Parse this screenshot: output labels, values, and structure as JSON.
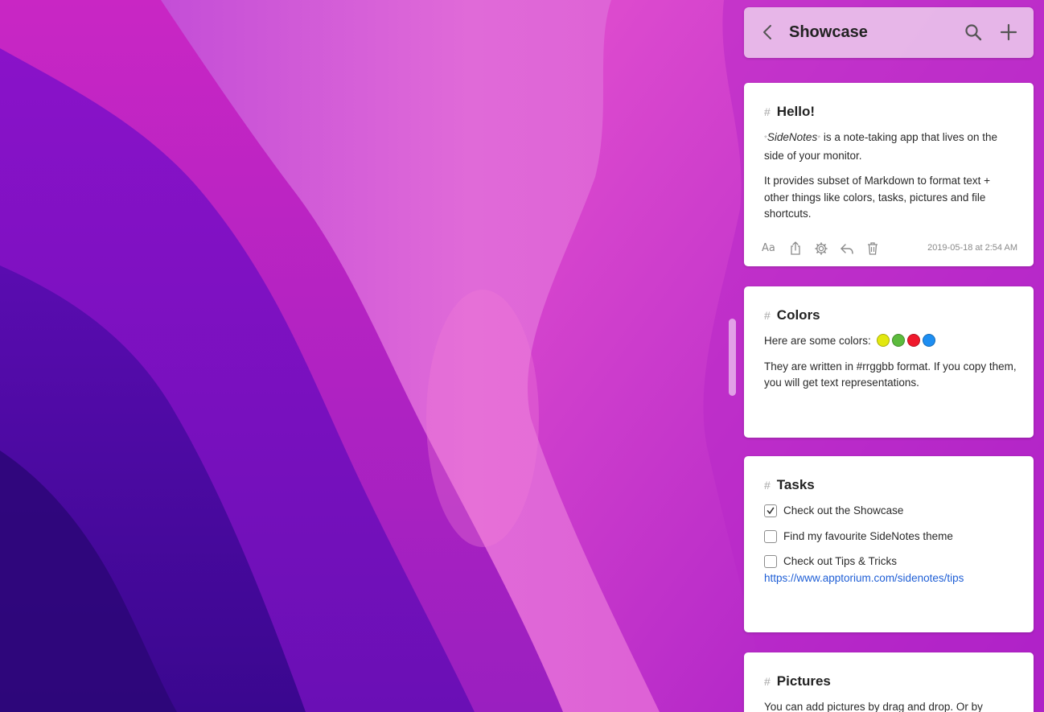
{
  "header": {
    "title": "Showcase",
    "back_icon": "chevron-left-icon",
    "search_icon": "search-icon",
    "add_icon": "plus-icon"
  },
  "notes": [
    {
      "title": "Hello!",
      "p1_app": "SideNotes",
      "p1_rest": " is a note-taking app that lives on the side of your monitor.",
      "p2": "It provides subset of Markdown to format text + other things like colors, tasks, pictures and file shortcuts.",
      "toolbar": {
        "font_label": "Aa",
        "timestamp": "2019-05-18 at 2:54 AM"
      }
    },
    {
      "title": "Colors",
      "p1": "Here are some colors:",
      "colors": [
        "#e2e80f",
        "#5cbb3d",
        "#f0192c",
        "#1d8ef2"
      ],
      "p2": "They are written in #rrggbb format. If you copy them, you will get text representations."
    },
    {
      "title": "Tasks",
      "tasks": [
        {
          "label": "Check out the Showcase",
          "done": true
        },
        {
          "label": "Find my favourite SideNotes theme",
          "done": false
        },
        {
          "label": "Check out Tips & Tricks ",
          "link": "https://www.apptorium.com/sidenotes/tips",
          "done": false
        }
      ]
    },
    {
      "title": "Pictures",
      "p1": "You can add pictures by drag and drop. Or by"
    }
  ],
  "colors": {
    "header_bg": "#ecc8ec",
    "link": "#1f5fd6",
    "hash": "#a8a8a8"
  }
}
